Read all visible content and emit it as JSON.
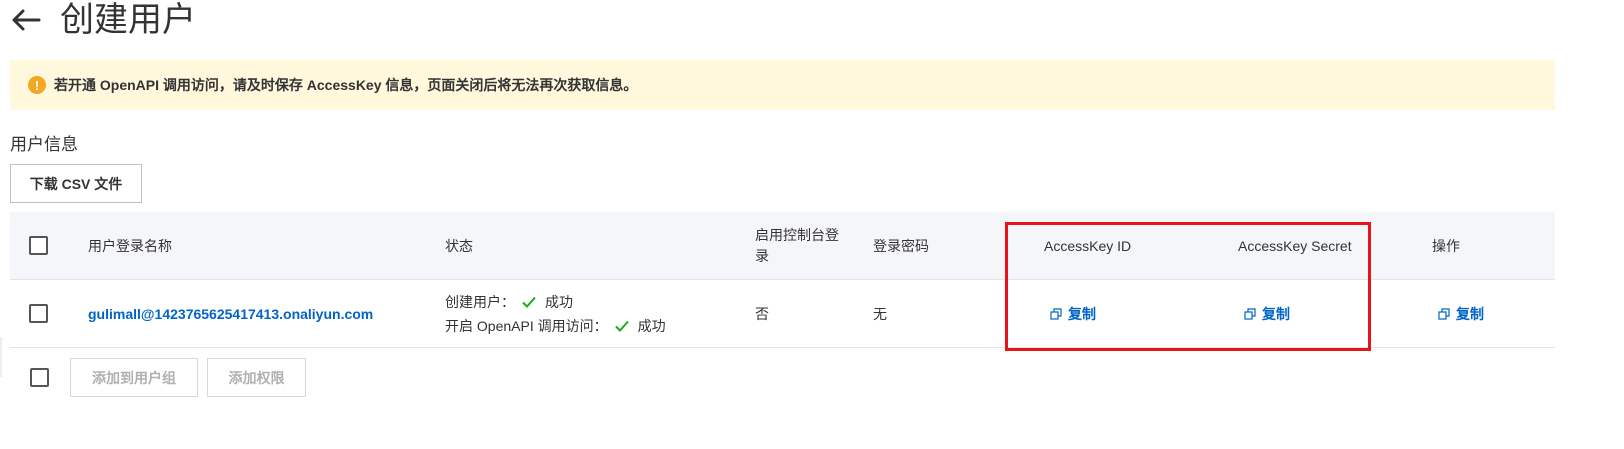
{
  "header": {
    "title": "创建用户",
    "back_icon": "arrow-left-icon"
  },
  "notice": {
    "icon": "exclamation-circle-icon",
    "text": "若开通 OpenAPI 调用访问，请及时保存 AccessKey 信息，页面关闭后将无法再次获取信息。",
    "color": "#fff8dc"
  },
  "section": {
    "title": "用户信息",
    "download_label": "下载 CSV 文件"
  },
  "table": {
    "columns": {
      "name": "用户登录名称",
      "status": "状态",
      "console_login": "启用控制台登录",
      "password": "登录密码",
      "access_key_id": "AccessKey ID",
      "access_key_secret": "AccessKey Secret",
      "actions": "操作"
    },
    "rows": [
      {
        "name": "gulimall@1423765625417413.onaliyun.com",
        "status_create_label": "创建用户：",
        "status_create_value": "成功",
        "status_api_label": "开启 OpenAPI 调用访问：",
        "status_api_value": "成功",
        "console_login": "否",
        "password": "无",
        "access_key_id_action": "复制",
        "access_key_secret_action": "复制",
        "actions_copy": "复制"
      }
    ]
  },
  "footer": {
    "add_group_label": "添加到用户组",
    "add_permission_label": "添加权限"
  },
  "colors": {
    "link": "#0064c8",
    "success": "#1aad19",
    "highlight": "#e8141b"
  }
}
